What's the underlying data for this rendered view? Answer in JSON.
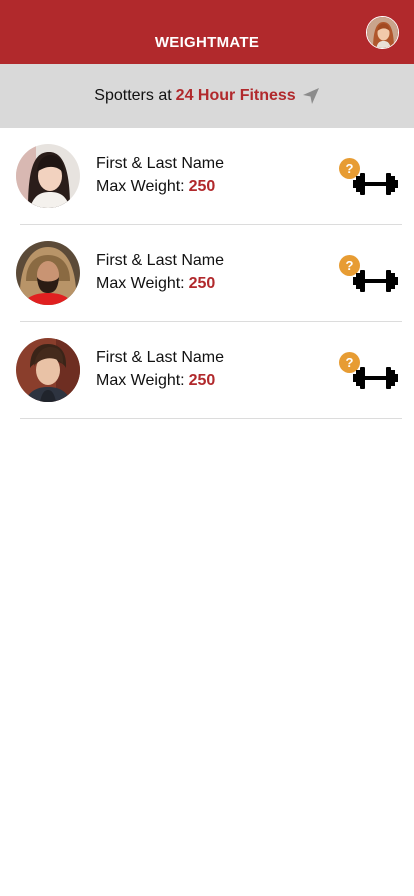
{
  "header": {
    "title": "WEIGHTMATE",
    "profile_avatar_icon": "user-avatar"
  },
  "location": {
    "prefix": "Spotters at",
    "gym_name": "24 Hour Fitness",
    "nav_icon": "location-arrow-icon"
  },
  "spotters": [
    {
      "name": "First & Last Name",
      "max_weight_label": "Max Weight:",
      "max_weight": "250",
      "badge": "?"
    },
    {
      "name": "First & Last Name",
      "max_weight_label": "Max Weight:",
      "max_weight": "250",
      "badge": "?"
    },
    {
      "name": "First & Last Name",
      "max_weight_label": "Max Weight:",
      "max_weight": "250",
      "badge": "?"
    }
  ],
  "colors": {
    "brand_red": "#b1292c",
    "location_bar_bg": "#d9d9d9",
    "badge_orange": "#e79c33",
    "divider": "#dcdcdc"
  }
}
